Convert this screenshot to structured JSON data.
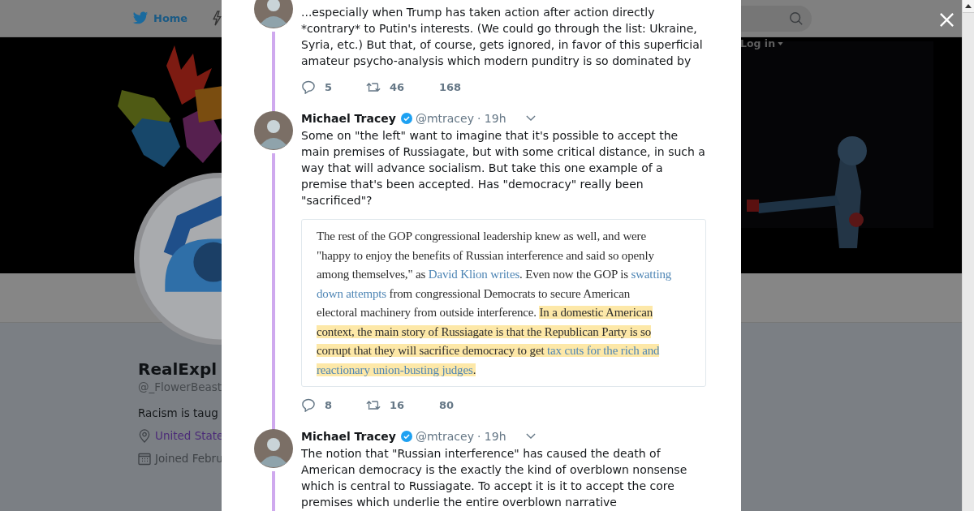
{
  "nav": {
    "home_label": "Home"
  },
  "login_label": "Log in",
  "profile": {
    "name": "RealExpl",
    "handle": "@_FlowerBeast",
    "bio": "Racism is taug",
    "location": "United State",
    "joined": "Joined Febru"
  },
  "thread": [
    {
      "text": "...especially when Trump has taken action after action directly *contrary* to Putin's interests. (We could go through the list: Ukraine, Syria, etc.) But that, of course, gets ignored, in favor of this superficial amateur psycho-analysis which modern punditry is so dominated by",
      "replies": "5",
      "retweets": "46",
      "likes": "168"
    },
    {
      "name": "Michael Tracey",
      "verified": true,
      "handle": "@mtracey",
      "time": "· 19h",
      "text": "Some on \"the left\" want to imagine that it's possible to accept the main premises of Russiagate, but with some critical distance, in such a way that will advance socialism. But take this one example of a premise that's been accepted. Has \"democracy\" really been \"sacrificed\"?",
      "quote": [
        [
          {
            "kind": "text",
            "highlight": false,
            "text": "The rest of the GOP congressional leadership knew as well, and were"
          }
        ],
        [
          {
            "kind": "text",
            "highlight": false,
            "text": "\"happy to enjoy the benefits of Russian interference and said so openly"
          }
        ],
        [
          {
            "kind": "text",
            "highlight": false,
            "text": "among themselves,\" as "
          },
          {
            "kind": "link",
            "highlight": false,
            "text": "David Klion writes"
          },
          {
            "kind": "text",
            "highlight": false,
            "text": ". Even now the GOP is "
          },
          {
            "kind": "link",
            "highlight": false,
            "text": "swatting"
          }
        ],
        [
          {
            "kind": "link",
            "highlight": false,
            "text": "down attempts"
          },
          {
            "kind": "text",
            "highlight": false,
            "text": " from congressional Democrats to secure American"
          }
        ],
        [
          {
            "kind": "text",
            "highlight": false,
            "text": "electoral machinery from outside interference. "
          },
          {
            "kind": "text",
            "highlight": true,
            "text": "In a domestic American"
          }
        ],
        [
          {
            "kind": "text",
            "highlight": true,
            "text": "context, the main story of Russiagate is that the Republican Party is so"
          }
        ],
        [
          {
            "kind": "text",
            "highlight": true,
            "text": "corrupt that they will sacrifice democracy to get "
          },
          {
            "kind": "link",
            "highlight": true,
            "text": "tax cuts for the rich and"
          }
        ],
        [
          {
            "kind": "link",
            "highlight": true,
            "text": "reactionary union-busting judges"
          },
          {
            "kind": "text",
            "highlight": true,
            "text": "."
          }
        ]
      ],
      "replies": "8",
      "retweets": "16",
      "likes": "80"
    },
    {
      "name": "Michael Tracey",
      "verified": true,
      "handle": "@mtracey",
      "time": "· 19h",
      "text": "The notion that \"Russian interference\" has caused the death of American democracy is the exactly the kind of overblown nonsense which is central to Russiagate. To accept it is it to accept the core premises which underlie the entire overblown narrative"
    }
  ]
}
